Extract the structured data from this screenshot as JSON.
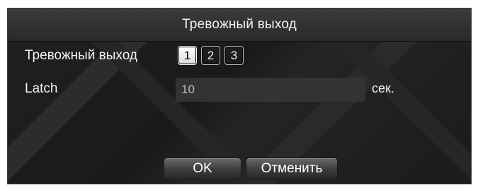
{
  "dialog": {
    "title": "Тревожный выход"
  },
  "alarm_output": {
    "label": "Тревожный выход",
    "channels": [
      "1",
      "2",
      "3"
    ],
    "selected": "1"
  },
  "latch": {
    "label": "Latch",
    "value": "10",
    "unit": "сек."
  },
  "buttons": {
    "ok": "OK",
    "cancel": "Отменить"
  },
  "colors": {
    "dialog_bg": "#1e1e1e",
    "titlebar_bg": "#333333",
    "field_bg": "#333333",
    "text": "#f4f4f4"
  }
}
